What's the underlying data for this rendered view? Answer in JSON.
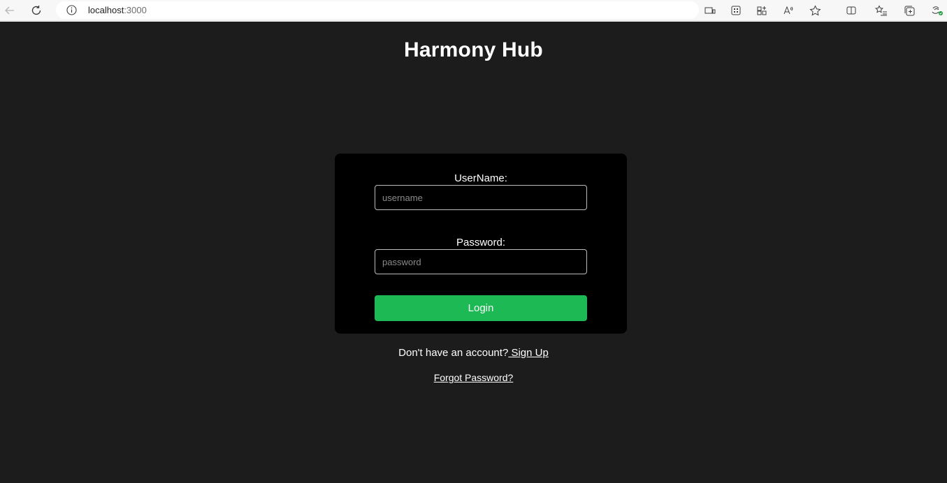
{
  "browser": {
    "url_host": "localhost",
    "url_port": ":3000",
    "icons": [
      "back-arrow-icon",
      "refresh-icon",
      "info-icon",
      "device-icon",
      "apps-icon",
      "grid-add-icon",
      "read-aloud-icon",
      "favorite-star-icon",
      "split-screen-icon",
      "favorites-list-icon",
      "collections-icon",
      "extensions-icon"
    ]
  },
  "app": {
    "title": "Harmony Hub"
  },
  "login_form": {
    "username_label": "UserName:",
    "username_placeholder": "username",
    "username_value": "",
    "password_label": "Password:",
    "password_placeholder": "password",
    "password_value": "",
    "login_label": "Login"
  },
  "footer": {
    "no_account_text": "Don't have an account?",
    "signup_label": " Sign Up",
    "forgot_label": "Forgot Password?"
  },
  "colors": {
    "page_background": "#1c1c1c",
    "card_background": "#000000",
    "login_button": "#1db954",
    "text": "#ffffff"
  }
}
